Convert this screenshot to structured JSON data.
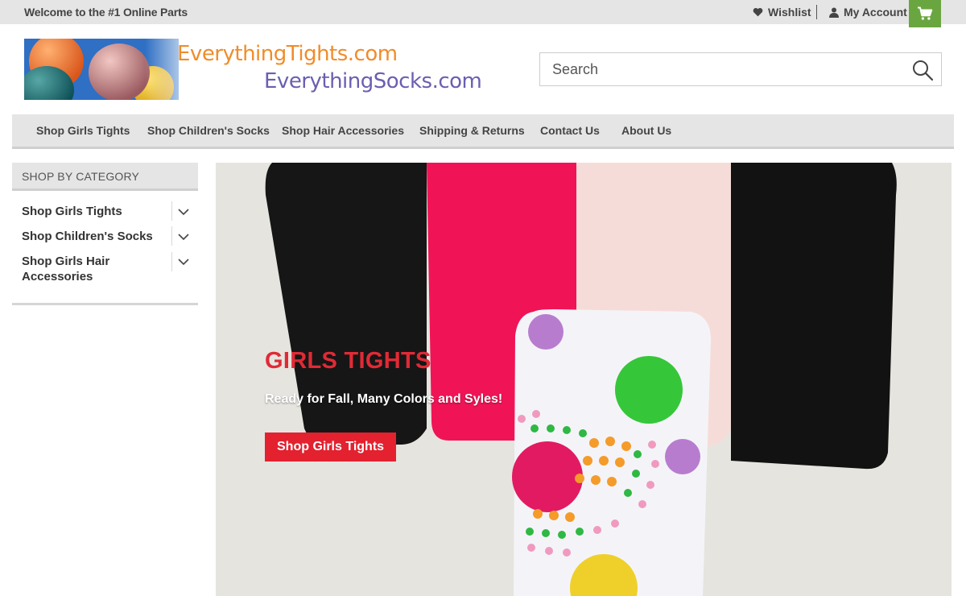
{
  "topbar": {
    "welcome": "Welcome to the #1 Online Parts",
    "wishlist_label": "Wishlist",
    "account_label": "My Account",
    "cart_color": "#6aa63f"
  },
  "header": {
    "logo_line1": "EverythingTights.com",
    "logo_line2": "EverythingSocks.com",
    "search_placeholder": "Search"
  },
  "nav": {
    "items": [
      {
        "label": "Shop Girls Tights"
      },
      {
        "label": "Shop Children's Socks"
      },
      {
        "label": "Shop Hair Accessories"
      },
      {
        "label": "Shipping & Returns"
      },
      {
        "label": "Contact Us"
      },
      {
        "label": "About Us"
      }
    ]
  },
  "sidebar": {
    "heading": "SHOP BY CATEGORY",
    "items": [
      {
        "label": "Shop Girls Tights"
      },
      {
        "label": "Shop Children's Socks"
      },
      {
        "label": "Shop Girls Hair Accessories"
      }
    ]
  },
  "hero": {
    "title": "GIRLS TIGHTS",
    "subtitle": "Ready for Fall, Many Colors and Syles!",
    "cta_label": "Shop Girls Tights",
    "accent_color": "#e3212f"
  }
}
